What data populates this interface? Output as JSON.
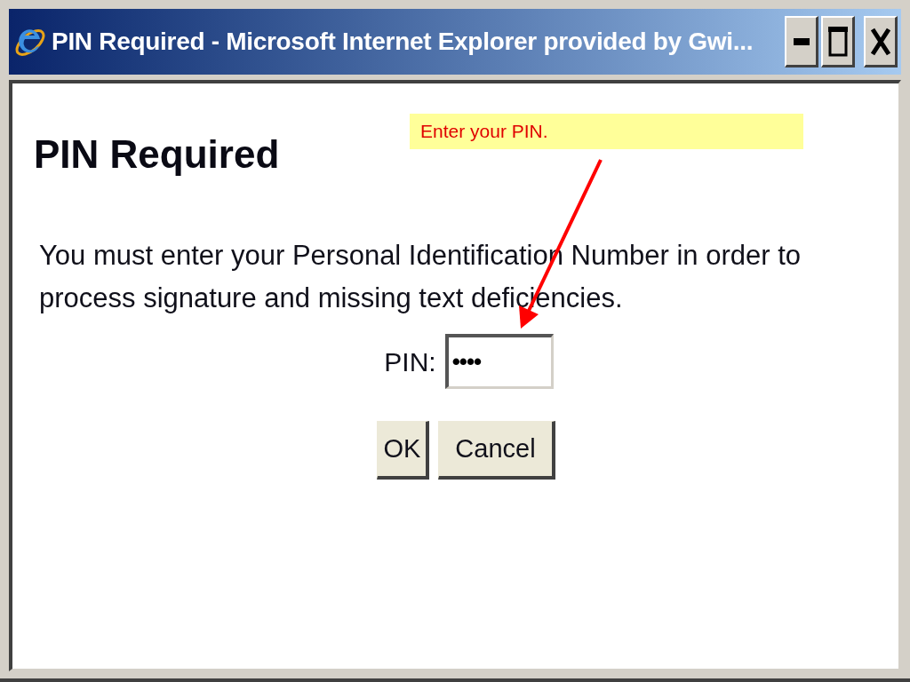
{
  "window": {
    "title": "PIN Required - Microsoft Internet Explorer provided by Gwi..."
  },
  "page": {
    "heading": "PIN Required",
    "message": "You must enter your Personal Identification Number in order to process signature and missing text deficiencies.",
    "pin_field": {
      "label": "PIN:",
      "value": "••••"
    },
    "buttons": [
      "OK",
      "Cancel"
    ]
  },
  "callout": {
    "text": "Enter your PIN."
  }
}
